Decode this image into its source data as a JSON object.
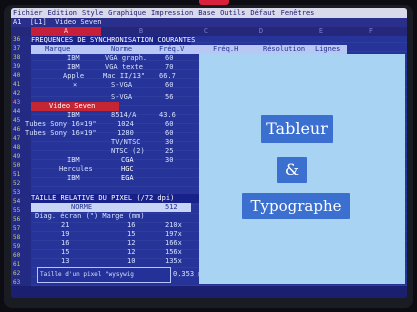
{
  "menubar": [
    "Fichier",
    "Edition",
    "Style",
    "Graphique",
    "Impression",
    "Base",
    "Outils",
    "Défaut",
    "Fenêtres"
  ],
  "cellref": "A1  [L1]  Video Seven",
  "columns": [
    "A",
    "B",
    "C",
    "D",
    "E",
    "F"
  ],
  "row_numbers": [
    "36",
    "37",
    "38",
    "39",
    "40",
    "41",
    "42",
    "43",
    "44",
    "45",
    "46",
    "47",
    "48",
    "49",
    "50",
    "51",
    "52",
    "53",
    "54",
    "55",
    "56",
    "57",
    "58",
    "59",
    "60",
    "61",
    "62",
    "63"
  ],
  "section1": {
    "title": "FREQUENCES DE SYNCHRONISATION COURANTES",
    "headers": [
      "Marque",
      "Norme",
      "Fréq.V",
      "Fréq.H",
      "Résolution",
      "Lignes"
    ],
    "rows": [
      {
        "marque": "IBM",
        "norme": "VGA graph.",
        "freqv": "60"
      },
      {
        "marque": "IBM",
        "norme": "VGA texte",
        "freqv": "70"
      },
      {
        "marque": "Apple",
        "norme": "Mac II/13\"",
        "freqv": "66.7"
      },
      {
        "marque": "×",
        "norme": "S-VGA",
        "freqv": "60"
      },
      {
        "marque": "Video Seven",
        "norme": "S-VGA",
        "freqv": "56"
      },
      {
        "marque": "IBM",
        "norme": "8514/A",
        "freqv": "43.6"
      },
      {
        "marque": "Tubes Sony 16¤19\"",
        "norme": "1024",
        "freqv": "60"
      },
      {
        "marque": "Tubes Sony 16¤19\"",
        "norme": "1280",
        "freqv": "60"
      },
      {
        "marque": "",
        "norme": "TV/NTSC",
        "freqv": "30"
      },
      {
        "marque": "",
        "norme": "NTSC (2)",
        "freqv": "25"
      },
      {
        "marque": "IBM",
        "norme": "CGA",
        "freqv": "30"
      },
      {
        "marque": "Hercules",
        "norme": "HGC",
        "freqv": ""
      },
      {
        "marque": "IBM",
        "norme": "EGA",
        "freqv": ""
      }
    ]
  },
  "section2": {
    "title": "TAILLE RELATIVE DU PIXEL (/72 dpi)",
    "label_norme": "NORME",
    "norme_value": "512",
    "subheader": "Diag. écran (\") Marge (mm)",
    "rows": [
      {
        "diag": "21",
        "marge": "16",
        "val": "210x"
      },
      {
        "diag": "19",
        "marge": "15",
        "val": "197x"
      },
      {
        "diag": "16",
        "marge": "12",
        "val": "166x"
      },
      {
        "diag": "15",
        "marge": "12",
        "val": "156x"
      },
      {
        "diag": "13",
        "marge": "10",
        "val": "135x"
      }
    ],
    "input_label": "Taille d'un pixel \"wysywig",
    "input_value": "0.353 mm"
  },
  "panel": {
    "btn1": "Tableur",
    "btn2": "&",
    "btn3": "Typographe"
  },
  "colors": {
    "screen_bg": "#1f2a86",
    "panel_bg": "#a9d3f2",
    "button_bg": "#3b6fd0",
    "selection_red": "#c42634",
    "header_light": "#b9c7f5"
  }
}
